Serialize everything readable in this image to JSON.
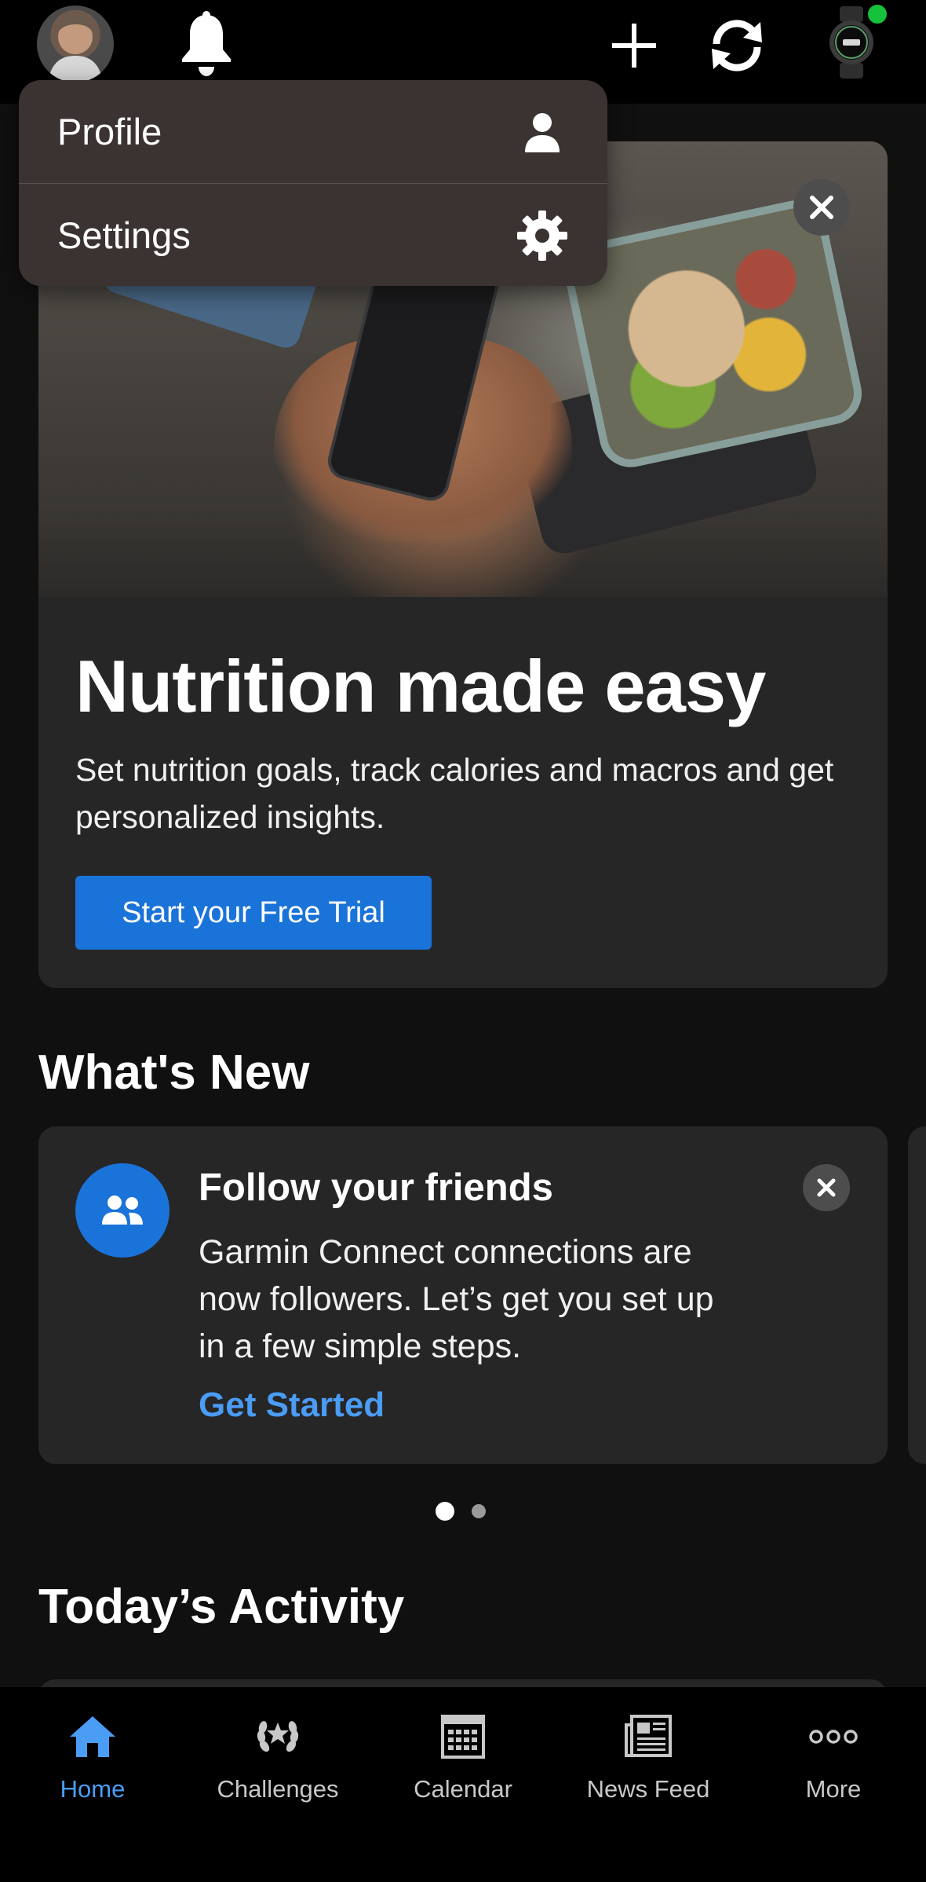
{
  "topbar": {
    "avatar_icon": "user-avatar-photo",
    "notifications_icon": "bell-icon",
    "add_icon": "plus-icon",
    "sync_icon": "sync-icon",
    "device_icon": "watch-icon",
    "device_status_color": "#17c23b"
  },
  "menu": {
    "items": [
      {
        "label": "Profile",
        "icon": "person-icon"
      },
      {
        "label": "Settings",
        "icon": "gear-icon"
      }
    ]
  },
  "hero": {
    "title": "Nutrition made easy",
    "description": "Set nutrition goals, track calories and macros and get personalized insights.",
    "cta": "Start your Free Trial",
    "close_icon": "close-icon",
    "accent_color": "#1a73d9"
  },
  "whats_new": {
    "title": "What's New",
    "card": {
      "icon": "friends-icon",
      "heading": "Follow your friends",
      "body": "Garmin Connect connections are now followers. Let’s get you set up in a few simple steps.",
      "link": "Get Started",
      "close_icon": "close-icon"
    },
    "page_indicator": {
      "current": 1,
      "total": 2
    }
  },
  "todays_activity": {
    "title": "Today’s Activity"
  },
  "bottom_nav": {
    "items": [
      {
        "label": "Home",
        "icon": "home-icon",
        "active": true
      },
      {
        "label": "Challenges",
        "icon": "laurel-icon",
        "active": false
      },
      {
        "label": "Calendar",
        "icon": "calendar-icon",
        "active": false
      },
      {
        "label": "News Feed",
        "icon": "newspaper-icon",
        "active": false
      },
      {
        "label": "More",
        "icon": "more-icon",
        "active": false
      }
    ],
    "active_color": "#4a9cf5"
  }
}
